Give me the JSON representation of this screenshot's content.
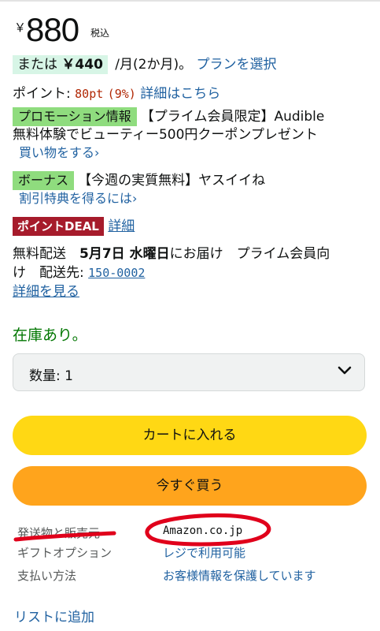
{
  "price": {
    "symbol": "￥",
    "value": "880",
    "tax_label": "税込"
  },
  "installment": {
    "prefix": "または",
    "amount": "￥440",
    "suffix": " /月(2か月)。",
    "plan_link": "プランを選択"
  },
  "points": {
    "label": "ポイント:",
    "value": "80pt",
    "percent": "(9%)",
    "details_link": "詳細はこちら"
  },
  "promotion": {
    "tag": "プロモーション情報",
    "line1": "【プライム会員限定】Audible",
    "line2": "無料体験でビューティー500円クーポンプレゼント",
    "shop_link": "買い物をする›"
  },
  "bonus": {
    "tag": "ボーナス",
    "text": "【今週の実質無料】ヤスイイね",
    "link": "割引特典を得るには›"
  },
  "point_deal": {
    "tag": "ポイントDEAL",
    "link": "詳細"
  },
  "delivery": {
    "prefix": "無料配送",
    "date": "5月7日 水曜日",
    "suffix": "にお届け　プライム会員向",
    "line2_prefix": "け　配送先:",
    "postal_code": "150-0002",
    "details_link": "詳細を見る"
  },
  "stock_status": "在庫あり。",
  "quantity": {
    "label": "数量:",
    "value": "1"
  },
  "buttons": {
    "add_to_cart": "カートに入れる",
    "buy_now": "今すぐ買う"
  },
  "seller_info": {
    "rows": [
      {
        "key": "発送物と販売元",
        "value": "Amazon.co.jp"
      },
      {
        "key": "ギフトオプション",
        "value": "レジで利用可能"
      },
      {
        "key": "支払い方法",
        "value": "お客様情報を保護しています"
      }
    ]
  },
  "add_to_list": "リストに追加",
  "colors": {
    "link": "#2162a1",
    "stock": "#007600",
    "cart_button": "#ffd814",
    "buy_button": "#ffa41c",
    "deal_tag": "#a61b2b",
    "promo_tag": "#8fdc7e",
    "annotation": "#e0001b"
  },
  "icons": {
    "quantity_dropdown": "chevron-down-icon"
  }
}
